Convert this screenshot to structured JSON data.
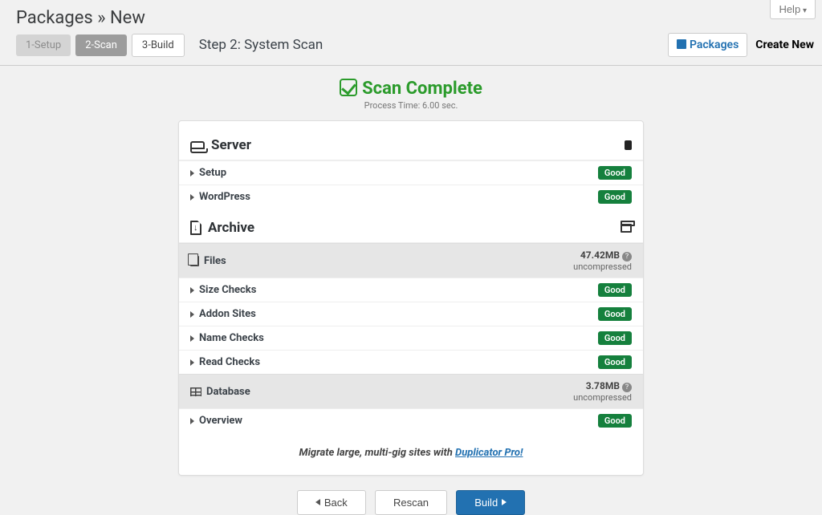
{
  "header": {
    "title": "Packages » New",
    "help_label": "Help"
  },
  "toolbar": {
    "steps": {
      "setup": "1-Setup",
      "scan": "2-Scan",
      "build": "3-Build"
    },
    "step_title": "Step 2: System Scan",
    "packages_link": "Packages",
    "create_new": "Create New"
  },
  "scan": {
    "title": "Scan Complete",
    "process_time": "Process Time: 6.00 sec."
  },
  "sections": {
    "server": {
      "title": "Server",
      "rows": [
        {
          "label": "Setup",
          "status": "Good"
        },
        {
          "label": "WordPress",
          "status": "Good"
        }
      ]
    },
    "archive": {
      "title": "Archive",
      "files": {
        "title": "Files",
        "size": "47.42MB",
        "note": "uncompressed",
        "rows": [
          {
            "label": "Size Checks",
            "status": "Good"
          },
          {
            "label": "Addon Sites",
            "status": "Good"
          },
          {
            "label": "Name Checks",
            "status": "Good"
          },
          {
            "label": "Read Checks",
            "status": "Good"
          }
        ]
      },
      "database": {
        "title": "Database",
        "size": "3.78MB",
        "note": "uncompressed",
        "rows": [
          {
            "label": "Overview",
            "status": "Good"
          }
        ]
      }
    }
  },
  "promo": {
    "text": "Migrate large, multi-gig sites with ",
    "link": "Duplicator Pro!"
  },
  "footer": {
    "back": "Back",
    "rescan": "Rescan",
    "build": "Build"
  }
}
